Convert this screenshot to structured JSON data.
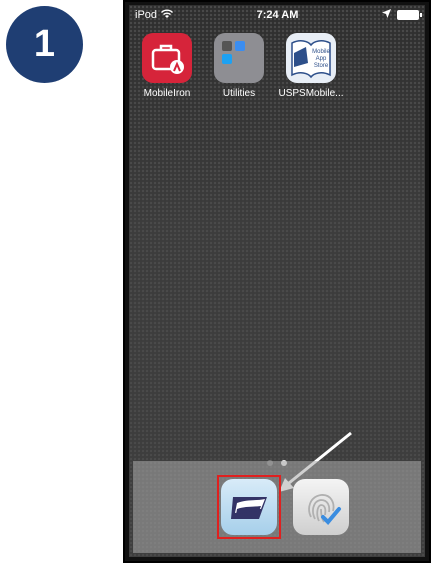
{
  "step": {
    "number": "1"
  },
  "status_bar": {
    "carrier": "iPod",
    "time": "7:24 AM"
  },
  "home_apps": [
    {
      "label": "MobileIron",
      "icon": "mobileiron-icon"
    },
    {
      "label": "Utilities",
      "icon": "utilities-folder-icon"
    },
    {
      "label": "USPSMobile...",
      "icon": "usps-mobile-app-store-icon",
      "icon_text": [
        "Mobile",
        "App",
        "Store"
      ]
    }
  ],
  "page_indicator": {
    "pages": 2,
    "current": 2
  },
  "dock_apps": [
    {
      "name": "usps-app-icon",
      "highlighted": true
    },
    {
      "name": "touch-id-app-icon",
      "highlighted": false
    }
  ],
  "colors": {
    "badge": "#1f3e73",
    "highlight": "#e0201f",
    "mobileiron": "#d6243a",
    "usps_blue": "#333366"
  }
}
